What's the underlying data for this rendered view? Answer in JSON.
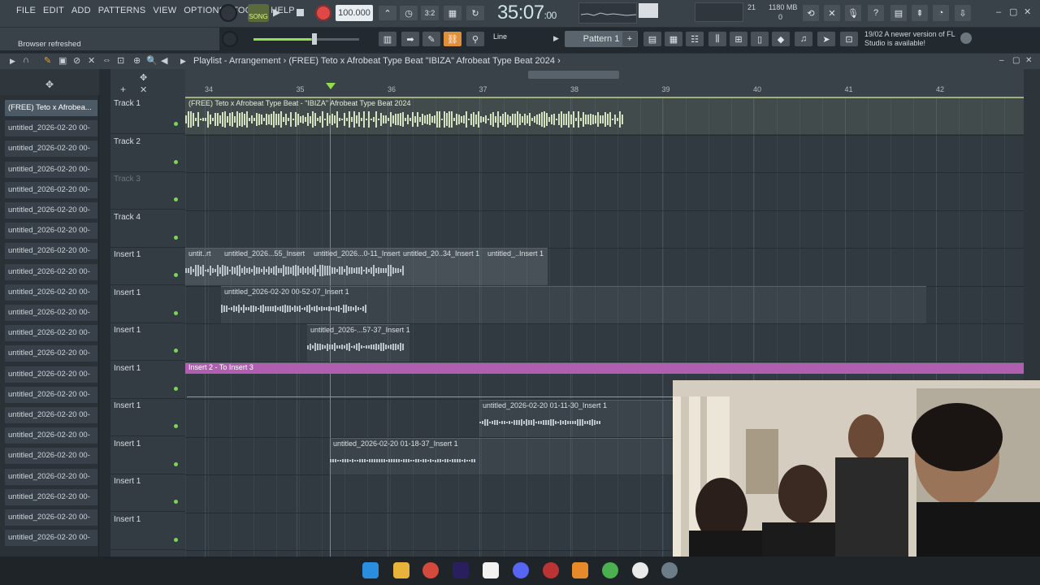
{
  "menu": [
    "FILE",
    "EDIT",
    "ADD",
    "PATTERNS",
    "VIEW",
    "OPTIONS",
    "TOOLS",
    "HELP"
  ],
  "hint": "Browser refreshed",
  "transport": {
    "song_label": "SONG",
    "tempo": "100.000",
    "time": "35:07",
    "time_frac": ":00"
  },
  "system": {
    "cpu_num": "21",
    "mem": "1180 MB",
    "mem2": "0"
  },
  "pattern": {
    "line": "Line",
    "name": "Pattern 1"
  },
  "update_notice": {
    "date": "19/02",
    "text": "A newer version of FL Studio is available!"
  },
  "playlist": {
    "title": "Playlist - Arrangement",
    "subtitle": "(FREE) Teto x Afrobeat Type Beat \"IBIZA\" Afrobeat Type Beat 2024"
  },
  "browser": {
    "items": [
      "(FREE) Teto x Afrobea...",
      "untitled_2026-02-20 00-",
      "untitled_2026-02-20 00-",
      "untitled_2026-02-20 00-",
      "untitled_2026-02-20 00-",
      "untitled_2026-02-20 00-",
      "untitled_2026-02-20 00-",
      "untitled_2026-02-20 00-",
      "untitled_2026-02-20 00-",
      "untitled_2026-02-20 00-",
      "untitled_2026-02-20 00-",
      "untitled_2026-02-20 00-",
      "untitled_2026-02-20 00-",
      "untitled_2026-02-20 00-",
      "untitled_2026-02-20 00-",
      "untitled_2026-02-20 00-",
      "untitled_2026-02-20 00-",
      "untitled_2026-02-20 00-",
      "untitled_2026-02-20 00-",
      "untitled_2026-02-20 00-",
      "untitled_2026-02-20 00-",
      "untitled_2026-02-20 00-"
    ]
  },
  "tracks": [
    "Track 1",
    "Track 2",
    "Track 3",
    "Track 4",
    "Insert 1",
    "Insert 1",
    "Insert 1",
    "Insert 1",
    "Insert 1",
    "Insert 1",
    "Insert 1",
    "Insert 1"
  ],
  "ruler": [
    "34",
    "35",
    "36",
    "37",
    "38",
    "39",
    "40",
    "41",
    "42"
  ],
  "clips": {
    "c1": "(FREE) Teto x Afrobeat Type Beat - \"IBIZA\" Afrobeat Type Beat 2024",
    "c2a": "untit..rt",
    "c2b": "untitled_2026...55_Insert",
    "c2c": "untitled_2026...0-11_Insert",
    "c2d": "untitled_20..34_Insert 1",
    "c2e": "untitled_..Insert 1",
    "c3": "untitled_2026-02-20 00-52-07_Insert 1",
    "c4": "untitled_2026-...57-37_Insert 1",
    "c5": "Insert 2 - To Insert 3",
    "c6": "untitled_2026-02-20 01-11-30_Insert 1",
    "c7": "untitled_2026-02-20 01-18-37_Insert 1"
  },
  "colors": {
    "accent_green": "#8fe04a",
    "record": "#e04848",
    "purple_clip": "#b05fb0"
  }
}
